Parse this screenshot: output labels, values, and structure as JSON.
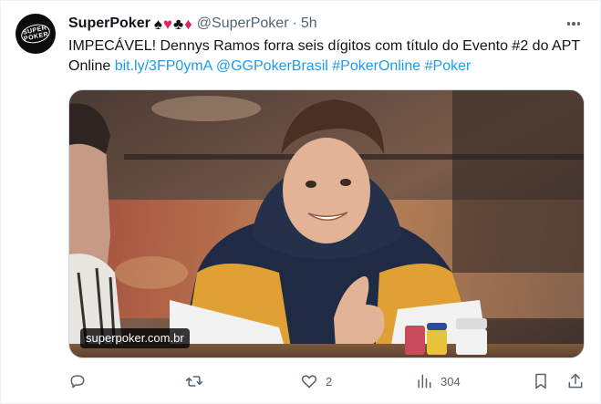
{
  "tweet": {
    "display_name": "SuperPoker",
    "suits": [
      {
        "glyph": "♠",
        "color": "black"
      },
      {
        "glyph": "♥",
        "color": "red"
      },
      {
        "glyph": "♣",
        "color": "black"
      },
      {
        "glyph": "♦",
        "color": "red"
      }
    ],
    "handle": "@SuperPoker",
    "separator": "·",
    "time": "5h",
    "text_main": "IMPECÁVEL! Dennys Ramos forra seis dígitos com título do Evento #2 do APT Online ",
    "links": [
      "bit.ly/3FP0ymA",
      "@GGPokerBrasil",
      "#PokerOnline",
      "#Poker"
    ],
    "media": {
      "domain_label": "superpoker.com.br"
    },
    "actions": {
      "reply_icon": "reply-icon",
      "retweet_icon": "retweet-icon",
      "like_icon": "heart-icon",
      "like_count": "2",
      "views_icon": "views-bar-chart-icon",
      "views_count": "304",
      "bookmark_icon": "bookmark-icon",
      "share_icon": "share-icon"
    },
    "avatar_logo_text": "SUPER POKER"
  },
  "colors": {
    "link": "#1d9bf0",
    "secondary_text": "#536471",
    "primary_text": "#0f1419",
    "suit_red": "#e0245e"
  }
}
